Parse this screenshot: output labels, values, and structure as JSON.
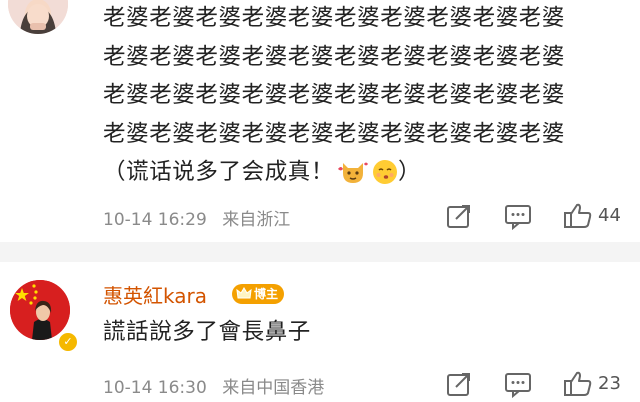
{
  "comments": [
    {
      "lines": [
        "老婆老婆老婆老婆老婆老婆老婆老婆老婆老婆",
        "老婆老婆老婆老婆老婆老婆老婆老婆老婆老婆",
        "老婆老婆老婆老婆老婆老婆老婆老婆老婆老婆",
        "老婆老婆老婆老婆老婆老婆老婆老婆老婆老婆",
        "（谎话说多了会成真！"
      ],
      "closing": "）",
      "emojis": [
        "cat-emoji",
        "kiss-emoji"
      ],
      "time": "10-14 16:29",
      "location": "来自浙江",
      "likes": "44"
    },
    {
      "username": "惠英紅kara",
      "badge": "博主",
      "text": "謊話說多了會長鼻子",
      "time": "10-14 16:30",
      "location": "来自中国香港",
      "likes": "23"
    }
  ],
  "colors": {
    "username": "#d35400",
    "badge": "#f4a000",
    "meta": "#8a8a8a",
    "separator": "#f4f4f4"
  }
}
